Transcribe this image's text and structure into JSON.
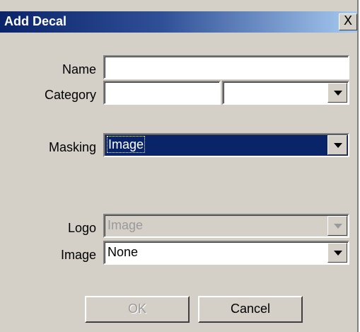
{
  "window": {
    "title": "Add Decal",
    "close_label": "X"
  },
  "name": {
    "label": "Name",
    "value": ""
  },
  "category": {
    "label": "Category",
    "value": "",
    "select_value": ""
  },
  "masking": {
    "label": "Masking",
    "value": "Image"
  },
  "logo": {
    "label": "Logo",
    "value": "Image",
    "disabled": true
  },
  "image": {
    "label": "Image",
    "value": "None"
  },
  "buttons": {
    "ok_label": "OK",
    "cancel_label": "Cancel"
  },
  "colors": {
    "titlebar": "#0a246a",
    "face": "#d4d0c8",
    "selection": "#0a246a"
  },
  "icons": {
    "close": "close-icon",
    "dropdown": "chevron-down-icon"
  }
}
